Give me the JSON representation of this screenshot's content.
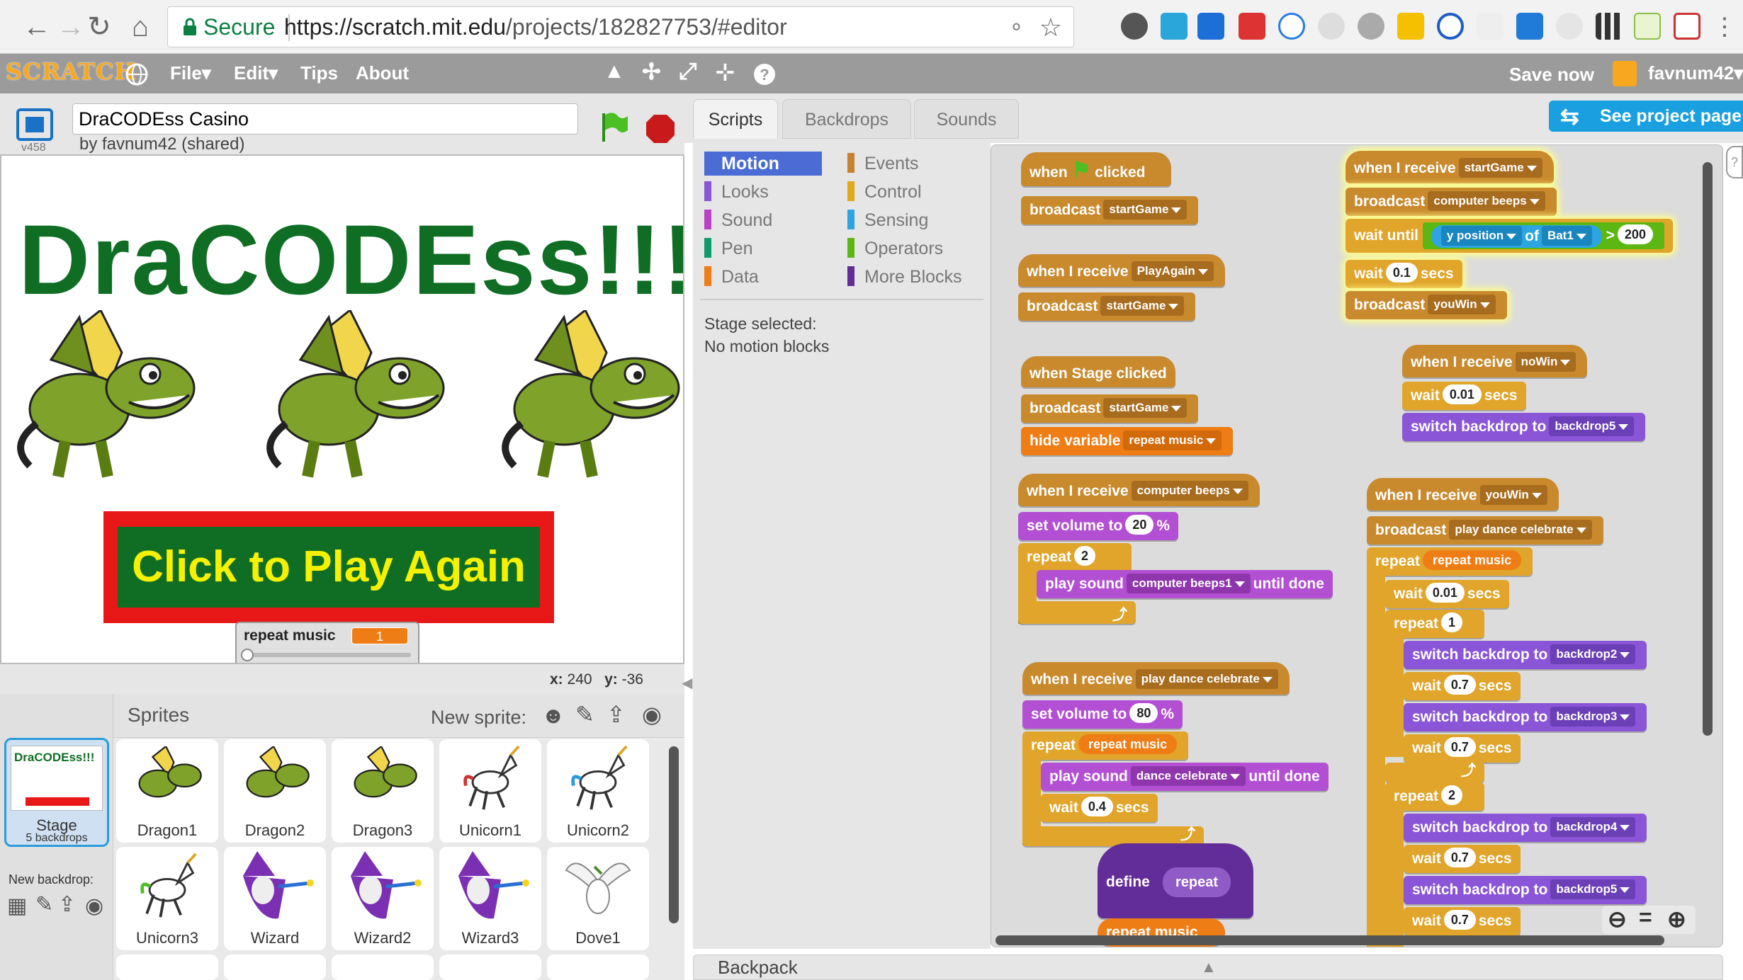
{
  "browser": {
    "secure_label": "Secure",
    "url_host": "https://scratch.mit.edu",
    "url_path": "/projects/182827753/#editor"
  },
  "menubar": {
    "logo": "SCRATCH",
    "file": "File",
    "edit": "Edit",
    "tips": "Tips",
    "about": "About",
    "save_now": "Save now",
    "username": "favnum42"
  },
  "project": {
    "version": "v458",
    "title": "DraCODEss Casino",
    "by_line": "by favnum42 (shared)"
  },
  "stage": {
    "headline": "DraCODEss!!!",
    "play_again": "Click to Play Again",
    "var_monitor_label": "repeat music",
    "var_monitor_value": "1",
    "x_label": "x:",
    "x_value": "240",
    "y_label": "y:",
    "y_value": "-36"
  },
  "sprites_panel": {
    "header": "Sprites",
    "new_sprite_label": "New sprite:",
    "stage_tile_label": "Stage",
    "stage_tile_sub": "5 backdrops",
    "stage_thumb_title": "DraCODEss!!!",
    "new_backdrop_label": "New backdrop:",
    "sprites": [
      "Dragon1",
      "Dragon2",
      "Dragon3",
      "Unicorn1",
      "Unicorn2",
      "Unicorn3",
      "Wizard",
      "Wizard2",
      "Wizard3",
      "Dove1"
    ]
  },
  "tabs": {
    "scripts": "Scripts",
    "backdrops": "Backdrops",
    "sounds": "Sounds",
    "see_project_page": "See project page"
  },
  "palette": {
    "left": [
      {
        "label": "Motion",
        "color": "#4a6cd4"
      },
      {
        "label": "Looks",
        "color": "#8a55d7"
      },
      {
        "label": "Sound",
        "color": "#bb42c3"
      },
      {
        "label": "Pen",
        "color": "#0e9a6c"
      },
      {
        "label": "Data",
        "color": "#ee7d16"
      }
    ],
    "right": [
      {
        "label": "Events",
        "color": "#c88330"
      },
      {
        "label": "Control",
        "color": "#e1a91a"
      },
      {
        "label": "Sensing",
        "color": "#2ca5e2"
      },
      {
        "label": "Operators",
        "color": "#5cb712"
      },
      {
        "label": "More Blocks",
        "color": "#632d99"
      }
    ],
    "selected_note_1": "Stage selected:",
    "selected_note_2": "No motion blocks"
  },
  "scripts": {
    "s1_hat_a": "when",
    "s1_hat_b": "clicked",
    "s1_broadcast": "broadcast",
    "s1_msg": "startGame",
    "s2_hat": "when I receive",
    "s2_msg": "PlayAgain",
    "s2_broadcast": "broadcast",
    "s2_bmsg": "startGame",
    "s3_hat": "when Stage clicked",
    "s3_broadcast": "broadcast",
    "s3_bmsg": "startGame",
    "s3_hide": "hide variable",
    "s3_var": "repeat music",
    "s4_hat": "when I receive",
    "s4_msg": "computer beeps",
    "s4_setvol": "set volume to",
    "s4_vol": "20",
    "s4_pct": "%",
    "s4_repeat": "repeat",
    "s4_times": "2",
    "s4_play": "play sound",
    "s4_sound": "computer beeps1",
    "s4_until": "until done",
    "s5_hat": "when I receive",
    "s5_msg": "play dance celebrate",
    "s5_setvol": "set volume to",
    "s5_vol": "80",
    "s5_pct": "%",
    "s5_repeat": "repeat",
    "s5_var": "repeat music",
    "s5_play": "play sound",
    "s5_sound": "dance celebrate",
    "s5_until": "until done",
    "s5_wait": "wait",
    "s5_wait_v": "0.4",
    "s5_secs": "secs",
    "s6_define": "define",
    "s6_param": "repeat",
    "s6_next": "repeat music",
    "s7_hat": "when I receive",
    "s7_msg": "startGame",
    "s7_broadcast": "broadcast",
    "s7_bmsg": "computer beeps",
    "s7_waituntil": "wait until",
    "s7_ypos": "y position",
    "s7_of": "of",
    "s7_obj": "Bat1",
    "s7_gt": ">",
    "s7_val": "200",
    "s7_wait": "wait",
    "s7_wait_v": "0.1",
    "s7_secs": "secs",
    "s7_broadcast2": "broadcast",
    "s7_bmsg2": "youWin",
    "s8_hat": "when I receive",
    "s8_msg": "noWin",
    "s8_wait": "wait",
    "s8_wait_v": "0.01",
    "s8_secs": "secs",
    "s8_switch": "switch backdrop to",
    "s8_bd": "backdrop5",
    "s9_hat": "when I receive",
    "s9_msg": "youWin",
    "s9_broadcast": "broadcast",
    "s9_bmsg": "play dance celebrate",
    "s9_repeat": "repeat",
    "s9_var": "repeat music",
    "s9_wait": "wait",
    "s9_wait_v": "0.01",
    "s9_secs": "secs",
    "s9_repeat2": "repeat",
    "s9_times2": "1",
    "s9_sw1": "switch backdrop to",
    "s9_bd1": "backdrop2",
    "s9_w1": "wait",
    "s9_w1v": "0.7",
    "s9_w1s": "secs",
    "s9_sw2": "switch backdrop to",
    "s9_bd2": "backdrop3",
    "s9_w2": "wait",
    "s9_w2v": "0.7",
    "s9_w2s": "secs",
    "s9_repeat3": "repeat",
    "s9_times3": "2",
    "s9_sw3": "switch backdrop to",
    "s9_bd3": "backdrop4",
    "s9_w3": "wait",
    "s9_w3v": "0.7",
    "s9_w3s": "secs",
    "s9_sw4": "switch backdrop to",
    "s9_bd4": "backdrop5",
    "s9_w4": "wait",
    "s9_w4v": "0.7",
    "s9_w4s": "secs"
  },
  "backpack": {
    "label": "Backpack"
  }
}
